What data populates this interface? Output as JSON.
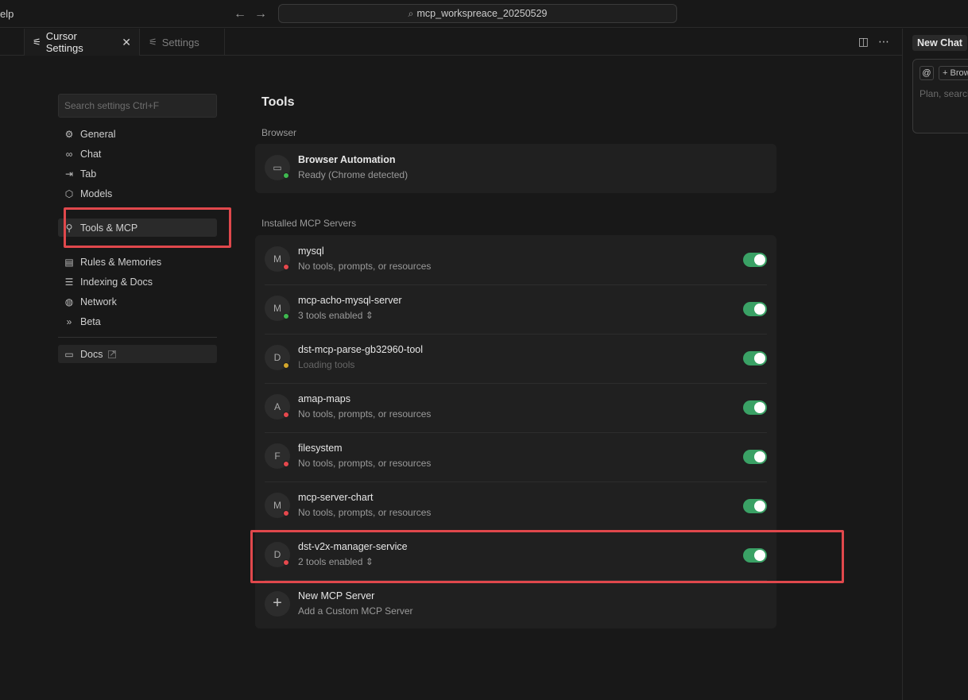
{
  "titlebar": {
    "menu_fragment": "elp",
    "back_icon": "arrow-left-icon",
    "forward_icon": "arrow-right-icon",
    "search_text": "mcp_workspreace_20250529"
  },
  "tabs": [
    {
      "label": "Cursor Settings",
      "icon": "sliders-icon",
      "active": true
    },
    {
      "label": "Settings",
      "icon": "sliders-icon",
      "active": false
    }
  ],
  "tab_actions": {
    "layout_icon": "split-layout-icon",
    "more_icon": "ellipsis-icon"
  },
  "chat": {
    "new_chat_label": "New Chat",
    "at_label": "@",
    "browse_label": "+ Browse",
    "placeholder": "Plan, search"
  },
  "sidebar": {
    "search_placeholder": "Search settings Ctrl+F",
    "items": [
      {
        "label": "General",
        "icon": "gear-icon"
      },
      {
        "label": "Chat",
        "icon": "infinity-icon"
      },
      {
        "label": "Tab",
        "icon": "tab-arrow-icon"
      },
      {
        "label": "Models",
        "icon": "cube-icon"
      },
      {
        "label": "Tools & MCP",
        "icon": "tools-icon",
        "active": true
      },
      {
        "label": "Rules & Memories",
        "icon": "clipboard-icon"
      },
      {
        "label": "Indexing & Docs",
        "icon": "database-icon"
      },
      {
        "label": "Network",
        "icon": "globe-icon"
      },
      {
        "label": "Beta",
        "icon": "double-chevron-icon"
      }
    ],
    "docs_label": "Docs"
  },
  "main": {
    "title": "Tools",
    "browser_section": "Browser",
    "browser_item": {
      "title": "Browser Automation",
      "subtitle": "Ready (Chrome detected)",
      "status": "#3fb950"
    },
    "mcp_section": "Installed MCP Servers",
    "servers": [
      {
        "initial": "M",
        "name": "mysql",
        "subtitle": "No tools, prompts, or resources",
        "status": "#e5484d",
        "enabled": true
      },
      {
        "initial": "M",
        "name": "mcp-acho-mysql-server",
        "subtitle": "3 tools enabled",
        "status": "#3fb950",
        "enabled": true,
        "expandable": true
      },
      {
        "initial": "D",
        "name": "dst-mcp-parse-gb32960-tool",
        "subtitle": "Loading tools",
        "status": "#d4a72c",
        "enabled": true,
        "dim": true
      },
      {
        "initial": "A",
        "name": "amap-maps",
        "subtitle": "No tools, prompts, or resources",
        "status": "#e5484d",
        "enabled": true
      },
      {
        "initial": "F",
        "name": "filesystem",
        "subtitle": "No tools, prompts, or resources",
        "status": "#e5484d",
        "enabled": true
      },
      {
        "initial": "M",
        "name": "mcp-server-chart",
        "subtitle": "No tools, prompts, or resources",
        "status": "#e5484d",
        "enabled": true
      },
      {
        "initial": "D",
        "name": "dst-v2x-manager-service",
        "subtitle": "2 tools enabled",
        "status": "#e5484d",
        "enabled": true,
        "expandable": true
      }
    ],
    "new_server": {
      "title": "New MCP Server",
      "subtitle": "Add a Custom MCP Server"
    }
  },
  "colors": {
    "highlight": "#e0484c",
    "toggle_on": "#3aa165"
  }
}
